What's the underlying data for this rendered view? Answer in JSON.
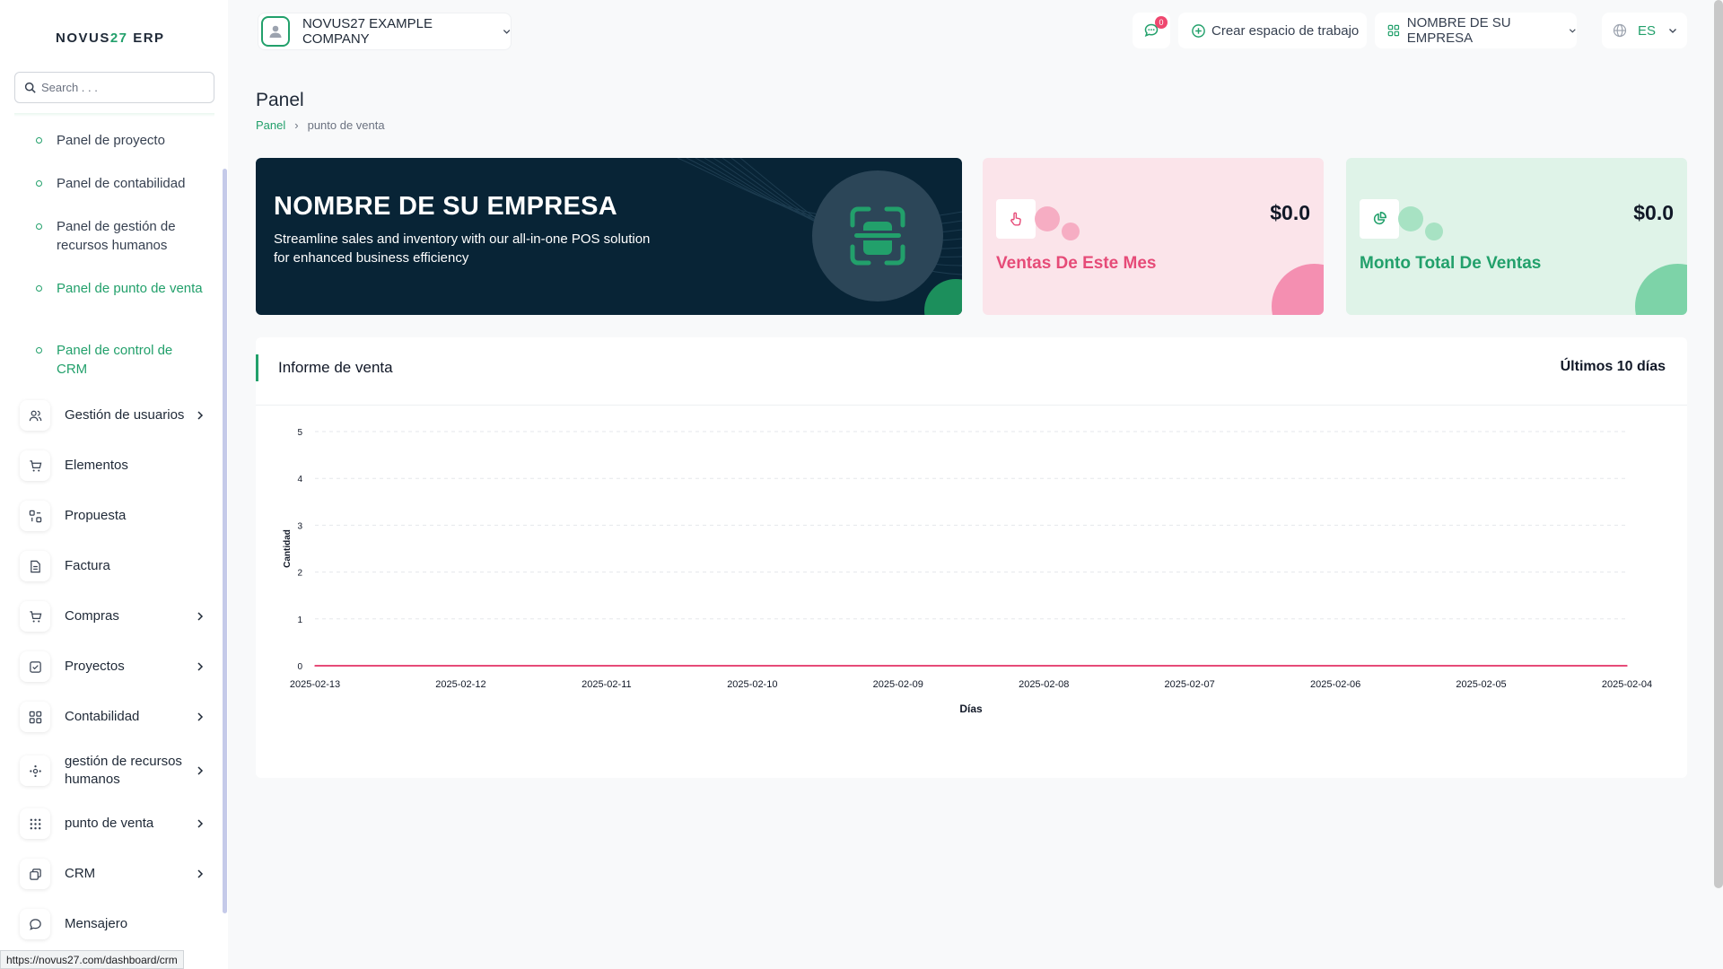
{
  "sidebar": {
    "logo_main": "NOVUS",
    "logo_num": "27",
    "logo_suffix": " ERP",
    "search_placeholder": "Search . . .",
    "sub_items": [
      {
        "label": "Panel de proyecto"
      },
      {
        "label": "Panel de contabilidad"
      },
      {
        "label": "Panel de gestión de recursos humanos"
      },
      {
        "label": "Panel de punto de venta"
      },
      {
        "label": "Panel de control de CRM"
      }
    ],
    "menu": [
      {
        "label": "Gestión de usuarios",
        "icon": "users-icon"
      },
      {
        "label": "Elementos",
        "icon": "cart-icon"
      },
      {
        "label": "Propuesta",
        "icon": "proposal-icon"
      },
      {
        "label": "Factura",
        "icon": "invoice-icon"
      },
      {
        "label": "Compras",
        "icon": "cart-icon"
      },
      {
        "label": "Proyectos",
        "icon": "check-square-icon"
      },
      {
        "label": "Contabilidad",
        "icon": "grid-icon"
      },
      {
        "label": "gestión de recursos humanos",
        "icon": "hr-icon"
      },
      {
        "label": "punto de venta",
        "icon": "dots-grid-icon"
      },
      {
        "label": "CRM",
        "icon": "layers-icon"
      },
      {
        "label": "Mensajero",
        "icon": "chat-icon"
      }
    ]
  },
  "status_url": "https://novus27.com/dashboard/crm",
  "topbar": {
    "company": "NOVUS27 EXAMPLE COMPANY",
    "message_count": "0",
    "workspace_label": "Crear espacio de trabajo",
    "business_label": "NOMBRE DE SU EMPRESA",
    "language": "ES"
  },
  "page": {
    "title": "Panel",
    "breadcrumb_home": "Panel",
    "breadcrumb_current": "punto de venta"
  },
  "hero": {
    "title": "NOMBRE DE SU EMPRESA",
    "description": "Streamline sales and inventory with our all-in-one POS solution for enhanced business efficiency"
  },
  "stats": {
    "month_sales_value": "$0.0",
    "month_sales_label": "Ventas De Este Mes",
    "total_sales_value": "$0.0",
    "total_sales_label": "Monto Total De Ventas"
  },
  "colors": {
    "accent": "#22a06b",
    "hero_bg": "#082436",
    "pink": "#e64b78",
    "line": "#e64b78"
  },
  "report": {
    "title": "Informe de venta",
    "range": "Últimos 10 días"
  },
  "chart_data": {
    "type": "line",
    "xlabel": "Días",
    "ylabel": "Cantidad",
    "ylim": [
      0,
      5
    ],
    "yticks": [
      0,
      1,
      2,
      3,
      4,
      5
    ],
    "grid": true,
    "categories": [
      "2025-02-13",
      "2025-02-12",
      "2025-02-11",
      "2025-02-10",
      "2025-02-09",
      "2025-02-08",
      "2025-02-07",
      "2025-02-06",
      "2025-02-05",
      "2025-02-04"
    ],
    "series": [
      {
        "values": [
          0,
          0,
          0,
          0,
          0,
          0,
          0,
          0,
          0,
          0
        ]
      }
    ]
  }
}
